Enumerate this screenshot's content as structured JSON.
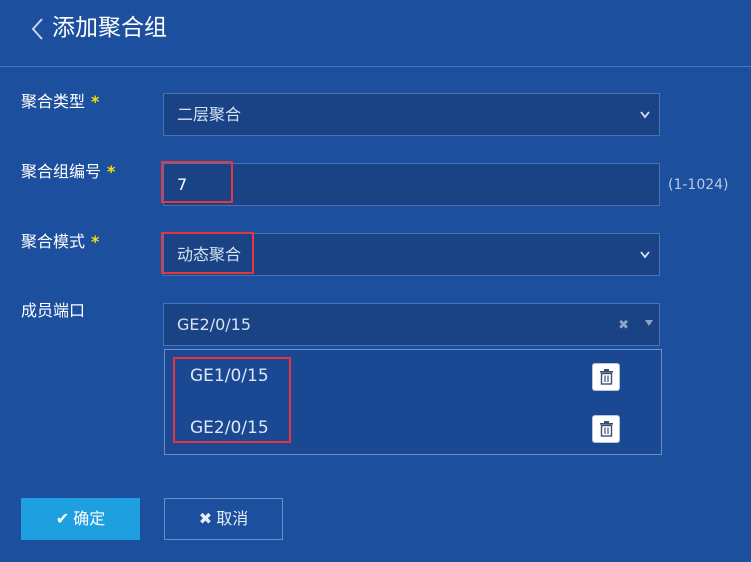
{
  "header": {
    "title": "添加聚合组",
    "back_icon": "chevron-left-icon"
  },
  "form": {
    "aggregation_type": {
      "label": "聚合类型",
      "required_mark": "*",
      "value": "二层聚合",
      "icon": "chevron-down-icon"
    },
    "group_number": {
      "label": "聚合组编号",
      "required_mark": "*",
      "value": "7",
      "range_hint": "(1-1024)"
    },
    "aggregation_mode": {
      "label": "聚合模式",
      "required_mark": "*",
      "value": "动态聚合",
      "icon": "chevron-down-icon"
    },
    "member_ports": {
      "label": "成员端口",
      "selected_value": "GE2/0/15",
      "clear_icon": "close-icon",
      "caret_icon": "caret-down-icon",
      "items": [
        {
          "label": "GE1/0/15",
          "icon": "trash-icon"
        },
        {
          "label": "GE2/0/15",
          "icon": "trash-icon"
        }
      ]
    }
  },
  "actions": {
    "confirm": {
      "label": "确定",
      "icon": "check-icon"
    },
    "cancel": {
      "label": "取消",
      "icon": "close-icon"
    }
  },
  "colors": {
    "background": "#1c4f9e",
    "accent": "#1ea0e0",
    "required": "#ffe000",
    "highlight": "#e5363f"
  }
}
